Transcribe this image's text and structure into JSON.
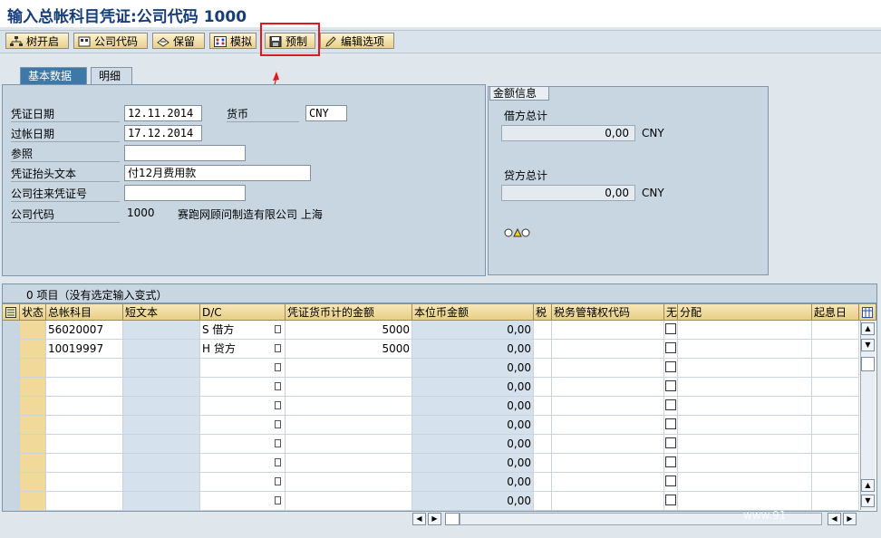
{
  "window": {
    "title": "输入总帐科目凭证:公司代码 1000"
  },
  "toolbar": {
    "tree_open": "树开启",
    "company_code": "公司代码",
    "hold": "保留",
    "simulate": "模拟",
    "park": "预制",
    "edit_options": "编辑选项"
  },
  "tabs": {
    "basic_data": "基本数据",
    "details": "明细"
  },
  "form": {
    "doc_date_label": "凭证日期",
    "doc_date": "12.11.2014",
    "posting_date_label": "过帐日期",
    "posting_date": "17.12.2014",
    "currency_label": "货币",
    "currency": "CNY",
    "reference_label": "参照",
    "reference": "",
    "header_text_label": "凭证抬头文本",
    "header_text": "付12月费用款",
    "cc_doc_no_label": "公司往来凭证号",
    "cc_doc_no": "",
    "company_code_label": "公司代码",
    "company_code_value": "1000",
    "company_name": "赛跑网顾问制造有限公司 上海"
  },
  "amount_info": {
    "tab_label": "金额信息",
    "debit_label": "借方总计",
    "debit_value": "0,00",
    "debit_currency": "CNY",
    "credit_label": "贷方总计",
    "credit_value": "0,00",
    "credit_currency": "CNY"
  },
  "grid": {
    "summary": "0 项目（没有选定输入变式）",
    "columns": [
      "状态",
      "总帐科目",
      "短文本",
      "D/C",
      "凭证货币计的金额",
      "本位币金额",
      "税",
      "税务管辖权代码",
      "无",
      "分配",
      "起息日"
    ],
    "rows": [
      {
        "account": "56020007",
        "short": "",
        "dc": "S 借方",
        "amount": "5000",
        "local": "0,00"
      },
      {
        "account": "10019997",
        "short": "",
        "dc": "H 贷方",
        "amount": "5000",
        "local": "0,00"
      },
      {
        "account": "",
        "short": "",
        "dc": "",
        "amount": "",
        "local": "0,00"
      },
      {
        "account": "",
        "short": "",
        "dc": "",
        "amount": "",
        "local": "0,00"
      },
      {
        "account": "",
        "short": "",
        "dc": "",
        "amount": "",
        "local": "0,00"
      },
      {
        "account": "",
        "short": "",
        "dc": "",
        "amount": "",
        "local": "0,00"
      },
      {
        "account": "",
        "short": "",
        "dc": "",
        "amount": "",
        "local": "0,00"
      },
      {
        "account": "",
        "short": "",
        "dc": "",
        "amount": "",
        "local": "0,00"
      },
      {
        "account": "",
        "short": "",
        "dc": "",
        "amount": "",
        "local": "0,00"
      },
      {
        "account": "",
        "short": "",
        "dc": "",
        "amount": "",
        "local": "0,00"
      }
    ]
  },
  "watermark": "www.91",
  "colors": {
    "title": "#163e7a",
    "highlight_box": "#e31818",
    "tab_active": "#3c78a8"
  }
}
